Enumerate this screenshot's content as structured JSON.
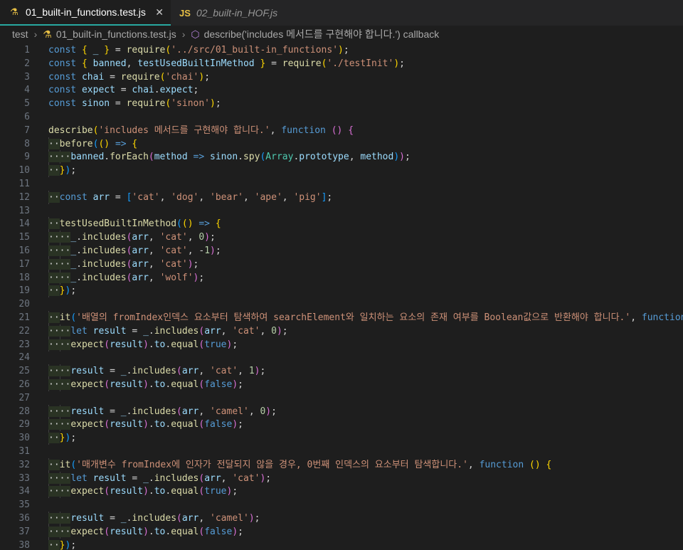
{
  "tabs": [
    {
      "label": "01_built-in_functions.test.js",
      "icon": "flask-icon",
      "active": true,
      "close": "✕"
    },
    {
      "label": "02_built-in_HOF.js",
      "icon": "js-file-icon",
      "icon_text": "JS",
      "active": false
    }
  ],
  "breadcrumb": [
    "test",
    "01_built-in_functions.test.js",
    "describe('includes 메서드를 구현해야 합니다.') callback"
  ],
  "code_lines": [
    "const { _ } = require('../src/01_built-in_functions');",
    "const { banned, testUsedBuiltInMethod } = require('./testInit');",
    "const chai = require('chai');",
    "const expect = chai.expect;",
    "const sinon = require('sinon');",
    "",
    "describe('includes 메서드를 구현해야 합니다.', function () {",
    "  before(() => {",
    "    banned.forEach(method => sinon.spy(Array.prototype, method));",
    "  });",
    "",
    "  const arr = ['cat', 'dog', 'bear', 'ape', 'pig'];",
    "",
    "  testUsedBuiltInMethod(() => {",
    "    _.includes(arr, 'cat', 0);",
    "    _.includes(arr, 'cat', -1);",
    "    _.includes(arr, 'cat');",
    "    _.includes(arr, 'wolf');",
    "  });",
    "",
    "  it('배열의 fromIndex인덱스 요소부터 탐색하여 searchElement와 일치하는 요소의 존재 여부를 Boolean값으로 반환해야 합니다.', function () {",
    "    let result = _.includes(arr, 'cat', 0);",
    "    expect(result).to.equal(true);",
    "",
    "    result = _.includes(arr, 'cat', 1);",
    "    expect(result).to.equal(false);",
    "",
    "    result = _.includes(arr, 'camel', 0);",
    "    expect(result).to.equal(false);",
    "  });",
    "",
    "  it('매개변수 fromIndex에 인자가 전달되지 않을 경우, 0번째 인덱스의 요소부터 탐색합니다.', function () {",
    "    let result = _.includes(arr, 'cat');",
    "    expect(result).to.equal(true);",
    "",
    "    result = _.includes(arr, 'camel');",
    "    expect(result).to.equal(false);",
    "  });"
  ],
  "colors": {
    "keyword": "#569cd6",
    "control": "#c586c0",
    "variable": "#9cdcfe",
    "function": "#dcdcaa",
    "string": "#ce9178",
    "number": "#b5cea8",
    "class": "#4ec9b0",
    "bracket1": "#ffd700",
    "bracket2": "#da70d6",
    "bracket3": "#179fff"
  }
}
